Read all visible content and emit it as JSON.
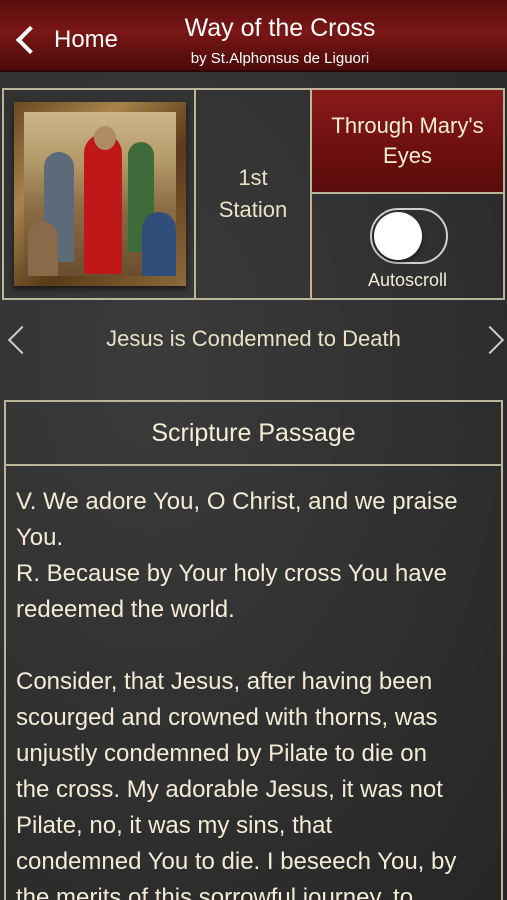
{
  "nav": {
    "back_label": "Home",
    "title": "Way of the Cross",
    "subtitle": "by St.Alphonsus de Liguori"
  },
  "station": {
    "line1": "1st",
    "line2": "Station",
    "name": "Jesus is Condemned to Death"
  },
  "mary_button": {
    "line1": "Through Mary's",
    "line2": "Eyes"
  },
  "autoscroll": {
    "label": "Autoscroll",
    "enabled": false
  },
  "passage": {
    "heading": "Scripture Passage",
    "v_line1": "V. We adore You, O Christ, and we praise",
    "v_line2": "You.",
    "r_line1": "R. Because by Your holy cross You have",
    "r_line2": "redeemed the world.",
    "body_lines": [
      "Consider, that Jesus, after having been",
      "scourged and crowned with thorns, was",
      "unjustly condemned by Pilate to die on",
      "the cross. My adorable Jesus, it was not",
      "Pilate, no, it was my sins, that",
      "condemned You to die. I beseech You, by",
      "the merits of this sorrowful journey, to"
    ]
  },
  "colors": {
    "nav_red": "#7a1616",
    "accent_border": "#b9b49a",
    "text": "#f2ecd6"
  }
}
